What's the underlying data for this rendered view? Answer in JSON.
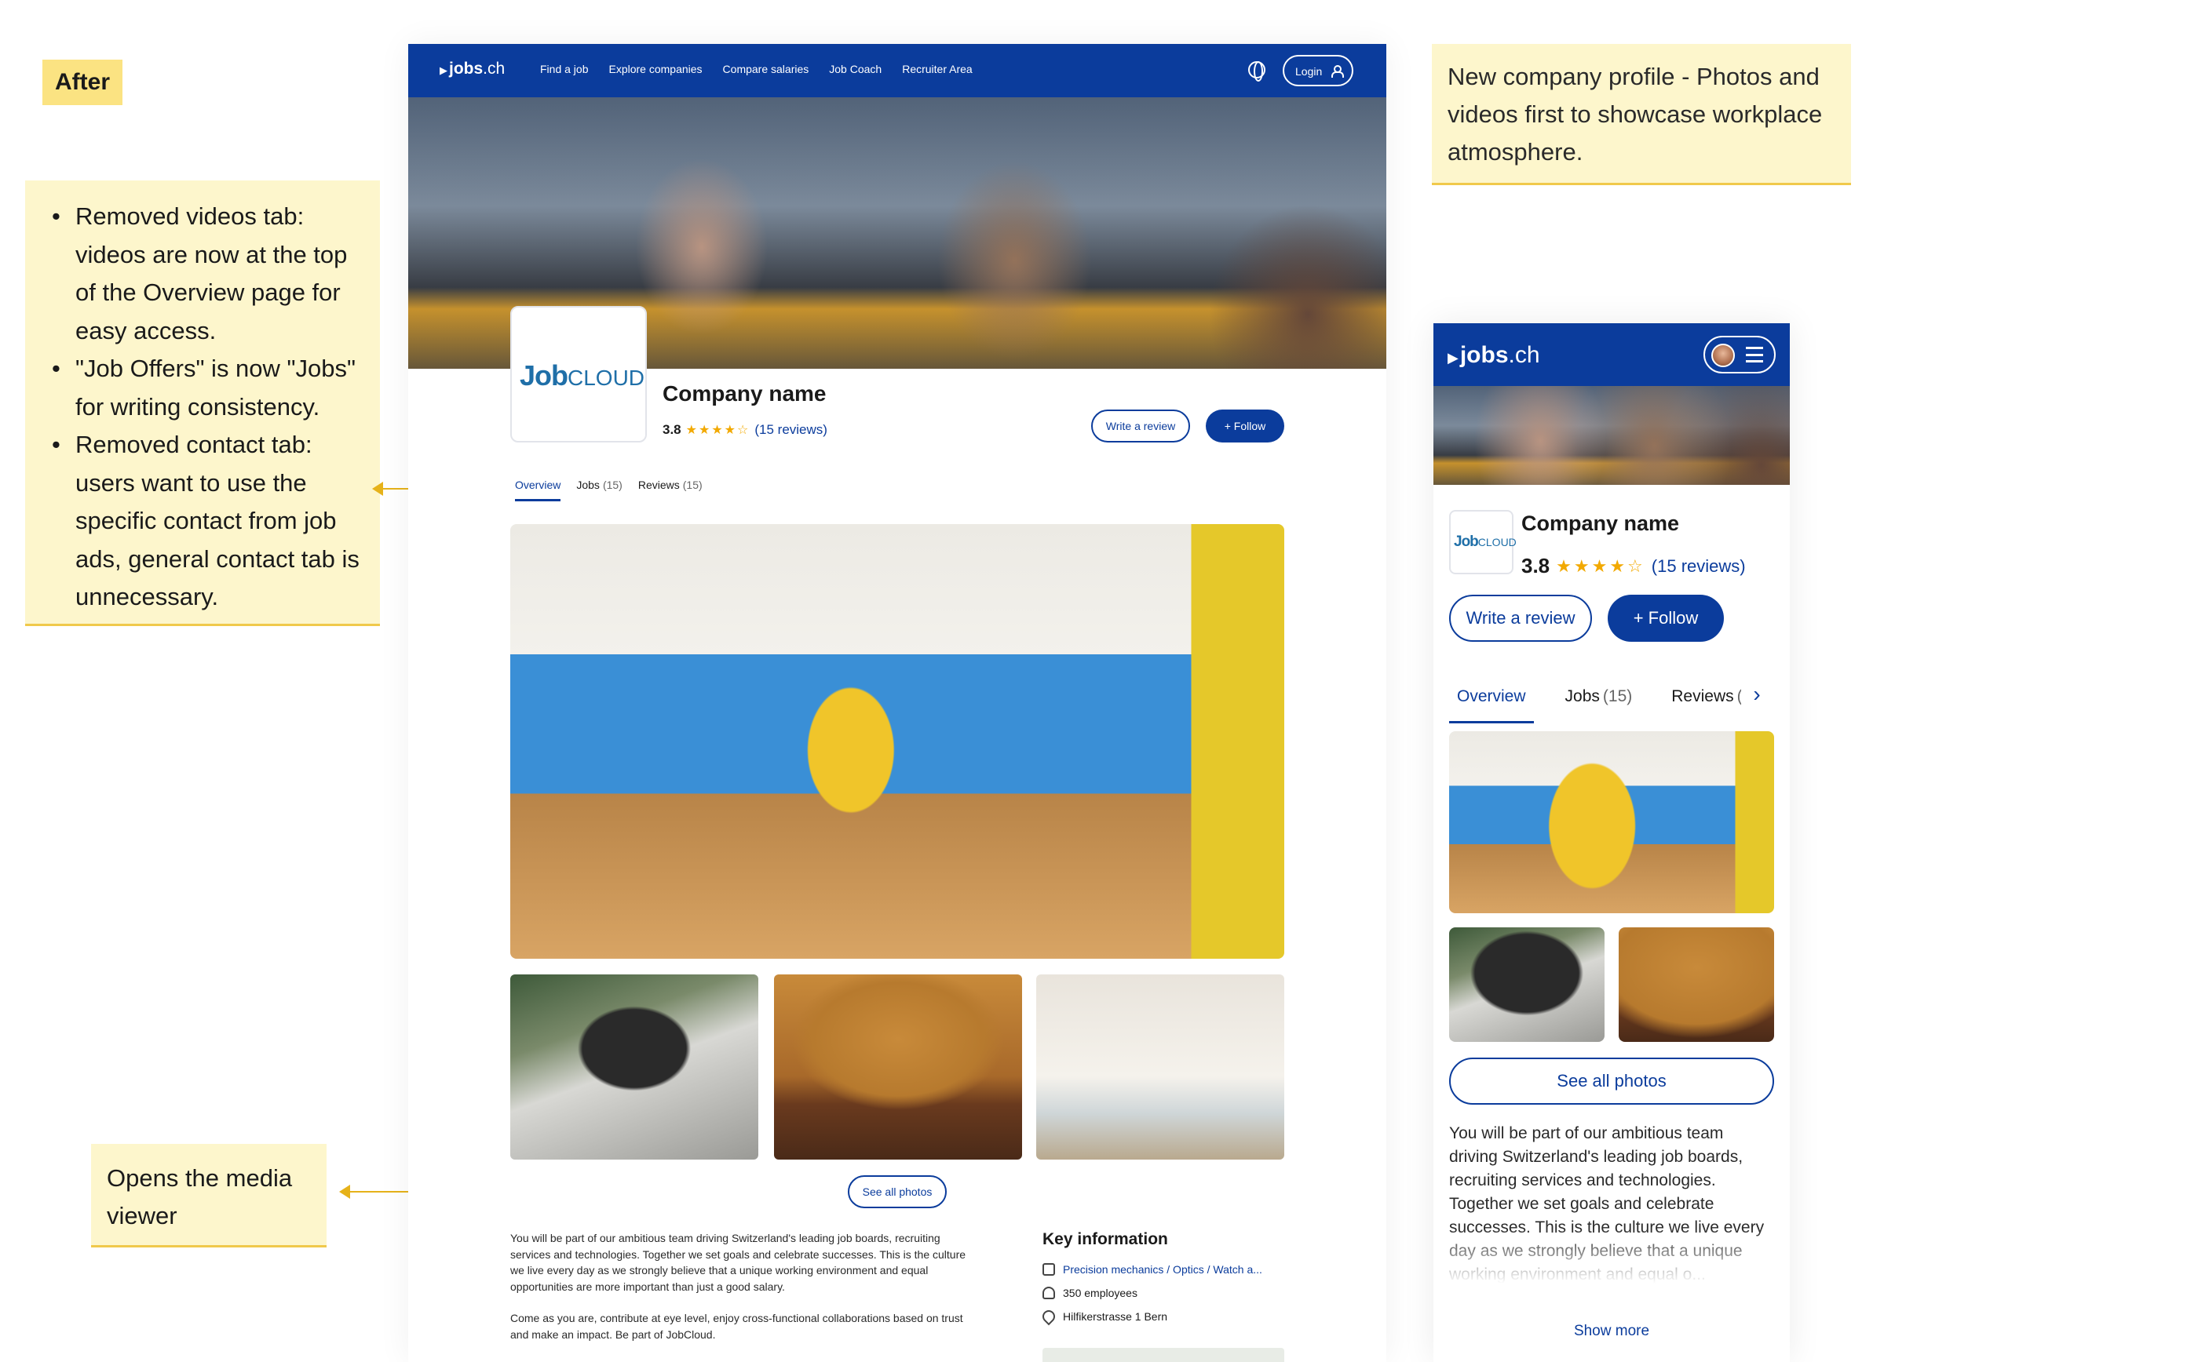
{
  "annotations": {
    "after_label": "After",
    "left_notes": [
      "Removed videos tab: videos are now at the top of the Overview page for easy access.",
      "\"Job Offers\" is now \"Jobs\" for writing consistency.",
      "Removed contact tab: users want to use the specific contact from job ads, general contact tab is unnecessary."
    ],
    "media_note": "Opens the media viewer",
    "right_note": "New company profile - Photos and videos first to showcase workplace atmosphere."
  },
  "desktop": {
    "logo": {
      "brand": "jobs",
      "tld": ".ch"
    },
    "nav_links": [
      "Find a job",
      "Explore companies",
      "Compare salaries",
      "Job Coach",
      "Recruiter Area"
    ],
    "login_label": "Login",
    "company_logo": {
      "strong": "Job",
      "light": "CLOUD"
    },
    "company_name": "Company name",
    "rating": "3.8",
    "stars": "★★★★☆",
    "reviews_link": "(15 reviews)",
    "write_review_label": "Write a review",
    "follow_label": "+ Follow",
    "tabs": [
      {
        "label": "Overview",
        "count": ""
      },
      {
        "label": "Jobs",
        "count": "(15)"
      },
      {
        "label": "Reviews",
        "count": "(15)"
      }
    ],
    "see_all_photos_label": "See all photos",
    "about_p1": "You will be part of our ambitious team driving Switzerland's leading job boards, recruiting services and technologies. Together we set goals and celebrate successes. This is the culture we live every day as we strongly believe that a unique working environment and equal opportunities are more important than just a good salary.",
    "about_p2": "Come as you are, contribute at eye level, enjoy cross-functional collaborations based on trust and make an impact. Be part of JobCloud.",
    "key_info": {
      "title": "Key information",
      "industry": "Precision mechanics / Optics / Watch a...",
      "employees": "350 employees",
      "address": "Hilfikerstrasse 1 Bern"
    }
  },
  "mobile": {
    "logo": {
      "brand": "jobs",
      "tld": ".ch"
    },
    "company_logo": {
      "strong": "Job",
      "light": "CLOUD"
    },
    "company_name": "Company name",
    "rating": "3.8",
    "stars": "★★★★☆",
    "reviews_link": "(15 reviews)",
    "write_review_label": "Write a review",
    "follow_label": "+ Follow",
    "tabs": [
      {
        "label": "Overview",
        "count": ""
      },
      {
        "label": "Jobs",
        "count": "(15)"
      },
      {
        "label": "Reviews",
        "count": "("
      }
    ],
    "see_all_photos_label": "See all photos",
    "about": "You will be part of our ambitious team driving Switzerland's leading job boards, recruiting services and technologies. Together we set goals and celebrate successes. This is the culture we live every day as we strongly believe that a unique working environment and equal o...",
    "show_more_label": "Show more"
  },
  "colors": {
    "brand_blue": "#0b3c9c",
    "star_gold": "#f2a900",
    "note_yellow": "#fdf6cc",
    "tag_yellow": "#fbe382",
    "arrow": "#e6b21a"
  }
}
